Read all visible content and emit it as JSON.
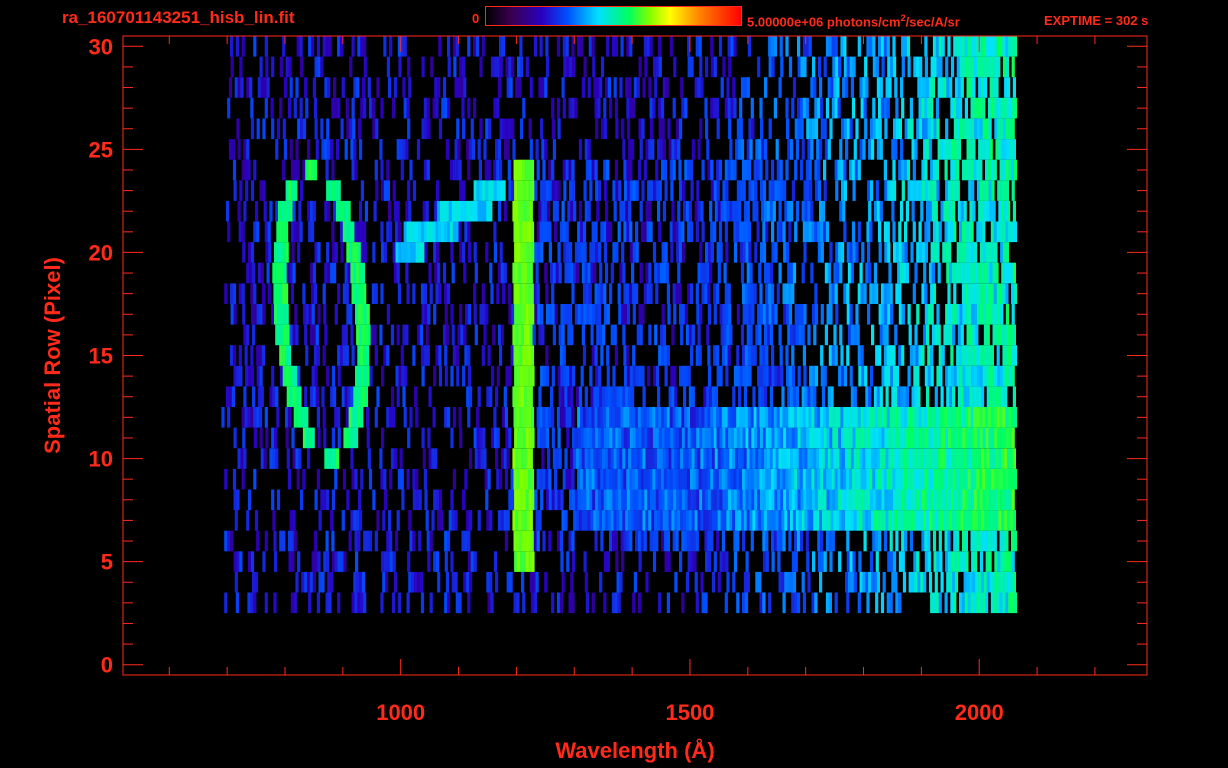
{
  "header": {
    "file_title": "ra_160701143251_hisb_lin.fit",
    "colorbar_min": "0",
    "colorbar_max_value": "5.00000e+06 photons/cm",
    "colorbar_max_exp": "2",
    "colorbar_max_unit": "/sec/A/sr",
    "exptime": "EXPTIME = 302 s"
  },
  "colors": {
    "text": "#ff2a1a",
    "background": "#000000",
    "colormap": [
      "#000000",
      "#3a0050",
      "#2a00c0",
      "#0050ff",
      "#00e0ff",
      "#00ff60",
      "#80ff00",
      "#ffff00",
      "#ff8000",
      "#ff0000"
    ]
  },
  "chart_data": {
    "type": "heatmap",
    "title": "ra_160701143251_hisb_lin.fit",
    "xlabel": "Wavelength (Å)",
    "ylabel": "Spatial Row (Pixel)",
    "xlim": [
      520,
      2290
    ],
    "ylim": [
      -0.5,
      30.5
    ],
    "x_ticks": [
      1000,
      1500,
      2000
    ],
    "y_ticks": [
      0,
      5,
      10,
      15,
      20,
      25,
      30
    ],
    "x_minor_step": 100,
    "y_minor_step": 1,
    "rows": [
      3,
      30
    ],
    "data_x_range": [
      690,
      2060
    ],
    "intensity_range": [
      0,
      5000000
    ],
    "intensity_unit": "photons/cm^2/sec/A/sr",
    "features": [
      {
        "name": "ring",
        "x_center": 860,
        "x_halfwidth": 70,
        "y_min": 10,
        "y_max": 24,
        "level": 0.5
      },
      {
        "name": "line",
        "x": 1210,
        "rows": [
          5,
          24
        ],
        "level": 0.6
      },
      {
        "name": "bridge",
        "x": [
          990,
          1180
        ],
        "rows": [
          20,
          23
        ],
        "level": 0.4
      }
    ]
  }
}
